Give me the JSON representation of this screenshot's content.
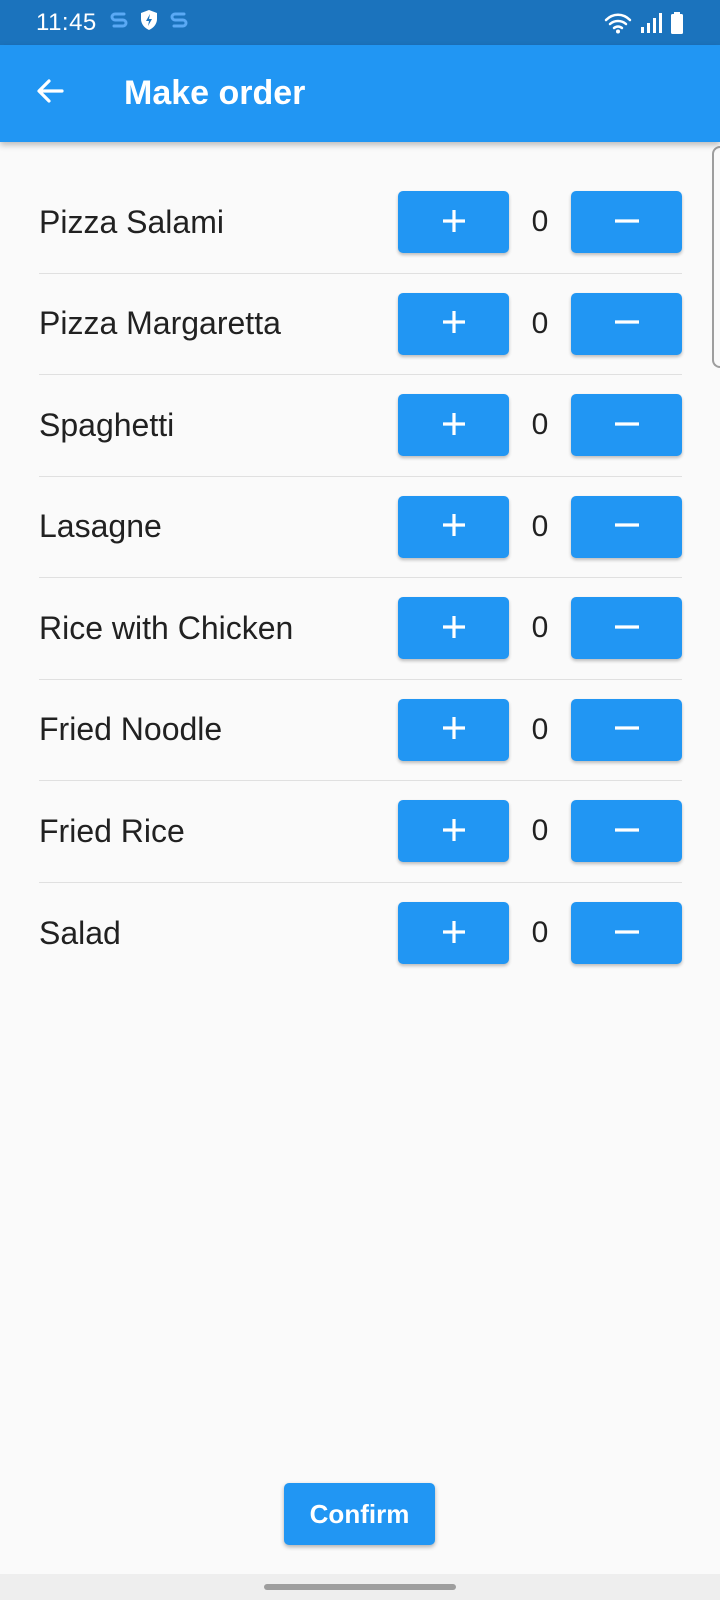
{
  "status_bar": {
    "time": "11:45",
    "left_icons": [
      "s-app-icon",
      "shield-bolt-icon",
      "s-app-icon"
    ],
    "right_icons": [
      "wifi-icon",
      "signal-icon",
      "battery-icon"
    ]
  },
  "app_bar": {
    "title": "Make order",
    "back_icon": "arrow-left-icon",
    "color": "#2196f3"
  },
  "menu": {
    "items": [
      {
        "name": "Pizza Salami",
        "quantity": "0"
      },
      {
        "name": "Pizza Margaretta",
        "quantity": "0"
      },
      {
        "name": "Spaghetti",
        "quantity": "0"
      },
      {
        "name": "Lasagne",
        "quantity": "0"
      },
      {
        "name": "Rice with Chicken",
        "quantity": "0"
      },
      {
        "name": "Fried Noodle",
        "quantity": "0"
      },
      {
        "name": "Fried Rice",
        "quantity": "0"
      },
      {
        "name": "Salad",
        "quantity": "0"
      }
    ],
    "increment_icon": "plus-icon",
    "decrement_icon": "minus-icon"
  },
  "confirm": {
    "label": "Confirm"
  }
}
